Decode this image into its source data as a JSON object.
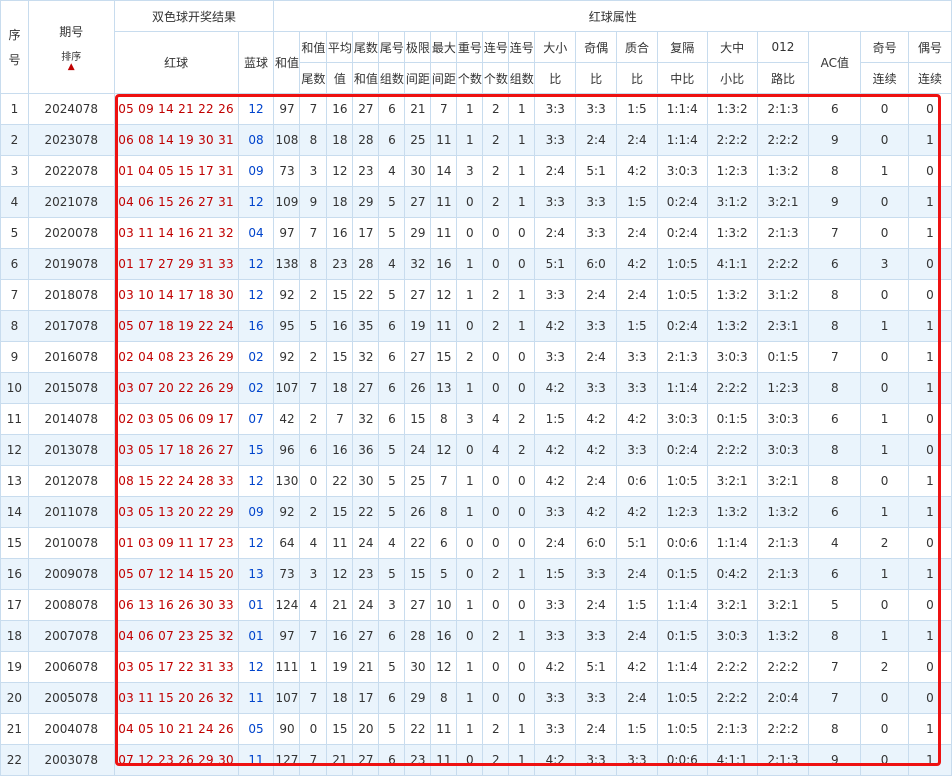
{
  "headers": {
    "seq": [
      "序",
      "号"
    ],
    "period": "期号",
    "sort": "排序",
    "draw_result": "双色球开奖结果",
    "red_ball": "红球",
    "blue_ball": "蓝球",
    "red_attr": "红球属性",
    "sub": [
      [
        "和值"
      ],
      [
        "和值",
        "尾数"
      ],
      [
        "平均",
        "值"
      ],
      [
        "尾数",
        "和值"
      ],
      [
        "尾号",
        "组数"
      ],
      [
        "极限",
        "间距"
      ],
      [
        "最大",
        "间距"
      ],
      [
        "重号",
        "个数"
      ],
      [
        "连号",
        "个数"
      ],
      [
        "连号",
        "组数"
      ],
      [
        "大小",
        "比"
      ],
      [
        "奇偶",
        "比"
      ],
      [
        "质合",
        "比"
      ],
      [
        "复隔",
        "中比"
      ],
      [
        "大中",
        "小比"
      ],
      [
        "012",
        "路比"
      ],
      [
        "AC值"
      ],
      [
        "奇号",
        "连续"
      ],
      [
        "偶号",
        "连续"
      ]
    ]
  },
  "rows": [
    [
      "1",
      "2024078",
      "05 09 14 21 22 26",
      "12",
      "97",
      "7",
      "16",
      "27",
      "6",
      "21",
      "7",
      "1",
      "2",
      "1",
      "3:3",
      "3:3",
      "1:5",
      "1:1:4",
      "1:3:2",
      "2:1:3",
      "6",
      "0",
      "0"
    ],
    [
      "2",
      "2023078",
      "06 08 14 19 30 31",
      "08",
      "108",
      "8",
      "18",
      "28",
      "6",
      "25",
      "11",
      "1",
      "2",
      "1",
      "3:3",
      "2:4",
      "2:4",
      "1:1:4",
      "2:2:2",
      "2:2:2",
      "9",
      "0",
      "1"
    ],
    [
      "3",
      "2022078",
      "01 04 05 15 17 31",
      "09",
      "73",
      "3",
      "12",
      "23",
      "4",
      "30",
      "14",
      "3",
      "2",
      "1",
      "2:4",
      "5:1",
      "4:2",
      "3:0:3",
      "1:2:3",
      "1:3:2",
      "8",
      "1",
      "0"
    ],
    [
      "4",
      "2021078",
      "04 06 15 26 27 31",
      "12",
      "109",
      "9",
      "18",
      "29",
      "5",
      "27",
      "11",
      "0",
      "2",
      "1",
      "3:3",
      "3:3",
      "1:5",
      "0:2:4",
      "3:1:2",
      "3:2:1",
      "9",
      "0",
      "1"
    ],
    [
      "5",
      "2020078",
      "03 11 14 16 21 32",
      "04",
      "97",
      "7",
      "16",
      "17",
      "5",
      "29",
      "11",
      "0",
      "0",
      "0",
      "2:4",
      "3:3",
      "2:4",
      "0:2:4",
      "1:3:2",
      "2:1:3",
      "7",
      "0",
      "1"
    ],
    [
      "6",
      "2019078",
      "01 17 27 29 31 33",
      "12",
      "138",
      "8",
      "23",
      "28",
      "4",
      "32",
      "16",
      "1",
      "0",
      "0",
      "5:1",
      "6:0",
      "4:2",
      "1:0:5",
      "4:1:1",
      "2:2:2",
      "6",
      "3",
      "0"
    ],
    [
      "7",
      "2018078",
      "03 10 14 17 18 30",
      "12",
      "92",
      "2",
      "15",
      "22",
      "5",
      "27",
      "12",
      "1",
      "2",
      "1",
      "3:3",
      "2:4",
      "2:4",
      "1:0:5",
      "1:3:2",
      "3:1:2",
      "8",
      "0",
      "0"
    ],
    [
      "8",
      "2017078",
      "05 07 18 19 22 24",
      "16",
      "95",
      "5",
      "16",
      "35",
      "6",
      "19",
      "11",
      "0",
      "2",
      "1",
      "4:2",
      "3:3",
      "1:5",
      "0:2:4",
      "1:3:2",
      "2:3:1",
      "8",
      "1",
      "1"
    ],
    [
      "9",
      "2016078",
      "02 04 08 23 26 29",
      "02",
      "92",
      "2",
      "15",
      "32",
      "6",
      "27",
      "15",
      "2",
      "0",
      "0",
      "3:3",
      "2:4",
      "3:3",
      "2:1:3",
      "3:0:3",
      "0:1:5",
      "7",
      "0",
      "1"
    ],
    [
      "10",
      "2015078",
      "03 07 20 22 26 29",
      "02",
      "107",
      "7",
      "18",
      "27",
      "6",
      "26",
      "13",
      "1",
      "0",
      "0",
      "4:2",
      "3:3",
      "3:3",
      "1:1:4",
      "2:2:2",
      "1:2:3",
      "8",
      "0",
      "1"
    ],
    [
      "11",
      "2014078",
      "02 03 05 06 09 17",
      "07",
      "42",
      "2",
      "7",
      "32",
      "6",
      "15",
      "8",
      "3",
      "4",
      "2",
      "1:5",
      "4:2",
      "4:2",
      "3:0:3",
      "0:1:5",
      "3:0:3",
      "6",
      "1",
      "0"
    ],
    [
      "12",
      "2013078",
      "03 05 17 18 26 27",
      "15",
      "96",
      "6",
      "16",
      "36",
      "5",
      "24",
      "12",
      "0",
      "4",
      "2",
      "4:2",
      "4:2",
      "3:3",
      "0:2:4",
      "2:2:2",
      "3:0:3",
      "8",
      "1",
      "0"
    ],
    [
      "13",
      "2012078",
      "08 15 22 24 28 33",
      "12",
      "130",
      "0",
      "22",
      "30",
      "5",
      "25",
      "7",
      "1",
      "0",
      "0",
      "4:2",
      "2:4",
      "0:6",
      "1:0:5",
      "3:2:1",
      "3:2:1",
      "8",
      "0",
      "1"
    ],
    [
      "14",
      "2011078",
      "03 05 13 20 22 29",
      "09",
      "92",
      "2",
      "15",
      "22",
      "5",
      "26",
      "8",
      "1",
      "0",
      "0",
      "3:3",
      "4:2",
      "4:2",
      "1:2:3",
      "1:3:2",
      "1:3:2",
      "6",
      "1",
      "1"
    ],
    [
      "15",
      "2010078",
      "01 03 09 11 17 23",
      "12",
      "64",
      "4",
      "11",
      "24",
      "4",
      "22",
      "6",
      "0",
      "0",
      "0",
      "2:4",
      "6:0",
      "5:1",
      "0:0:6",
      "1:1:4",
      "2:1:3",
      "4",
      "2",
      "0"
    ],
    [
      "16",
      "2009078",
      "05 07 12 14 15 20",
      "13",
      "73",
      "3",
      "12",
      "23",
      "5",
      "15",
      "5",
      "0",
      "2",
      "1",
      "1:5",
      "3:3",
      "2:4",
      "0:1:5",
      "0:4:2",
      "2:1:3",
      "6",
      "1",
      "1"
    ],
    [
      "17",
      "2008078",
      "06 13 16 26 30 33",
      "01",
      "124",
      "4",
      "21",
      "24",
      "3",
      "27",
      "10",
      "1",
      "0",
      "0",
      "3:3",
      "2:4",
      "1:5",
      "1:1:4",
      "3:2:1",
      "3:2:1",
      "5",
      "0",
      "0"
    ],
    [
      "18",
      "2007078",
      "04 06 07 23 25 32",
      "01",
      "97",
      "7",
      "16",
      "27",
      "6",
      "28",
      "16",
      "0",
      "2",
      "1",
      "3:3",
      "3:3",
      "2:4",
      "0:1:5",
      "3:0:3",
      "1:3:2",
      "8",
      "1",
      "1"
    ],
    [
      "19",
      "2006078",
      "03 05 17 22 31 33",
      "12",
      "111",
      "1",
      "19",
      "21",
      "5",
      "30",
      "12",
      "1",
      "0",
      "0",
      "4:2",
      "5:1",
      "4:2",
      "1:1:4",
      "2:2:2",
      "2:2:2",
      "7",
      "2",
      "0"
    ],
    [
      "20",
      "2005078",
      "03 11 15 20 26 32",
      "11",
      "107",
      "7",
      "18",
      "17",
      "6",
      "29",
      "8",
      "1",
      "0",
      "0",
      "3:3",
      "3:3",
      "2:4",
      "1:0:5",
      "2:2:2",
      "2:0:4",
      "7",
      "0",
      "0"
    ],
    [
      "21",
      "2004078",
      "04 05 10 21 24 26",
      "05",
      "90",
      "0",
      "15",
      "20",
      "5",
      "22",
      "11",
      "1",
      "2",
      "1",
      "3:3",
      "2:4",
      "1:5",
      "1:0:5",
      "2:1:3",
      "2:2:2",
      "8",
      "0",
      "1"
    ],
    [
      "22",
      "2003078",
      "07 12 23 26 29 30",
      "11",
      "127",
      "7",
      "21",
      "27",
      "6",
      "23",
      "11",
      "0",
      "2",
      "1",
      "4:2",
      "3:3",
      "3:3",
      "0:0:6",
      "4:1:1",
      "2:1:3",
      "9",
      "0",
      "1"
    ]
  ],
  "colors": {
    "red_number": "#c00000",
    "blue_number": "#0044cc",
    "highlight_border": "#ee1111",
    "row_stripe": "#eaf4fc",
    "grid": "#c8dcee"
  },
  "icons": {
    "sort": "sort-arrow-up-icon"
  }
}
